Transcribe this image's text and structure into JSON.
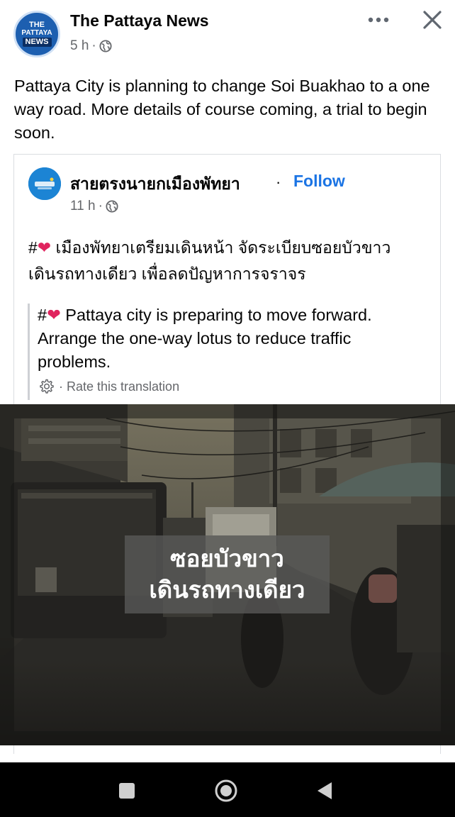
{
  "post": {
    "page_name": "The Pattaya News",
    "avatar_text": [
      "THE",
      "PATTAYA",
      "NEWS"
    ],
    "time": "5 h",
    "separator": "·",
    "text": "Pattaya City is planning to change Soi Buakhao to a one way road. More details of course coming, a trial to begin soon."
  },
  "shared_post": {
    "page_name": "สายตรงนายกเมืองพัทยา",
    "bullet": "·",
    "follow_label": "Follow",
    "time": "11 h",
    "separator": "·",
    "hash": "#",
    "thai_text": " เมืองพัทยาเตรียมเดินหน้า จัดระเบียบซอยบัวขาวเดินรถทางเดียว เพื่อลดปัญหาการจราจร",
    "translation": " Pattaya city is preparing to move forward. Arrange the one-way lotus to reduce traffic problems.",
    "rate_label": "· Rate this translation"
  },
  "photo": {
    "caption_line1": "ซอยบัวขาว",
    "caption_line2": "เดินรถทางเดียว"
  },
  "icons": {
    "globe": "globe-icon",
    "more": "more-horizontal-icon",
    "close": "close-icon",
    "heart": "heart-icon",
    "gear": "gear-icon",
    "nav_recent": "square-icon",
    "nav_home": "circle-icon",
    "nav_back": "triangle-back-icon"
  },
  "colors": {
    "link": "#1b74e4",
    "secondary_text": "#65676b",
    "heart": "#e0245e"
  }
}
